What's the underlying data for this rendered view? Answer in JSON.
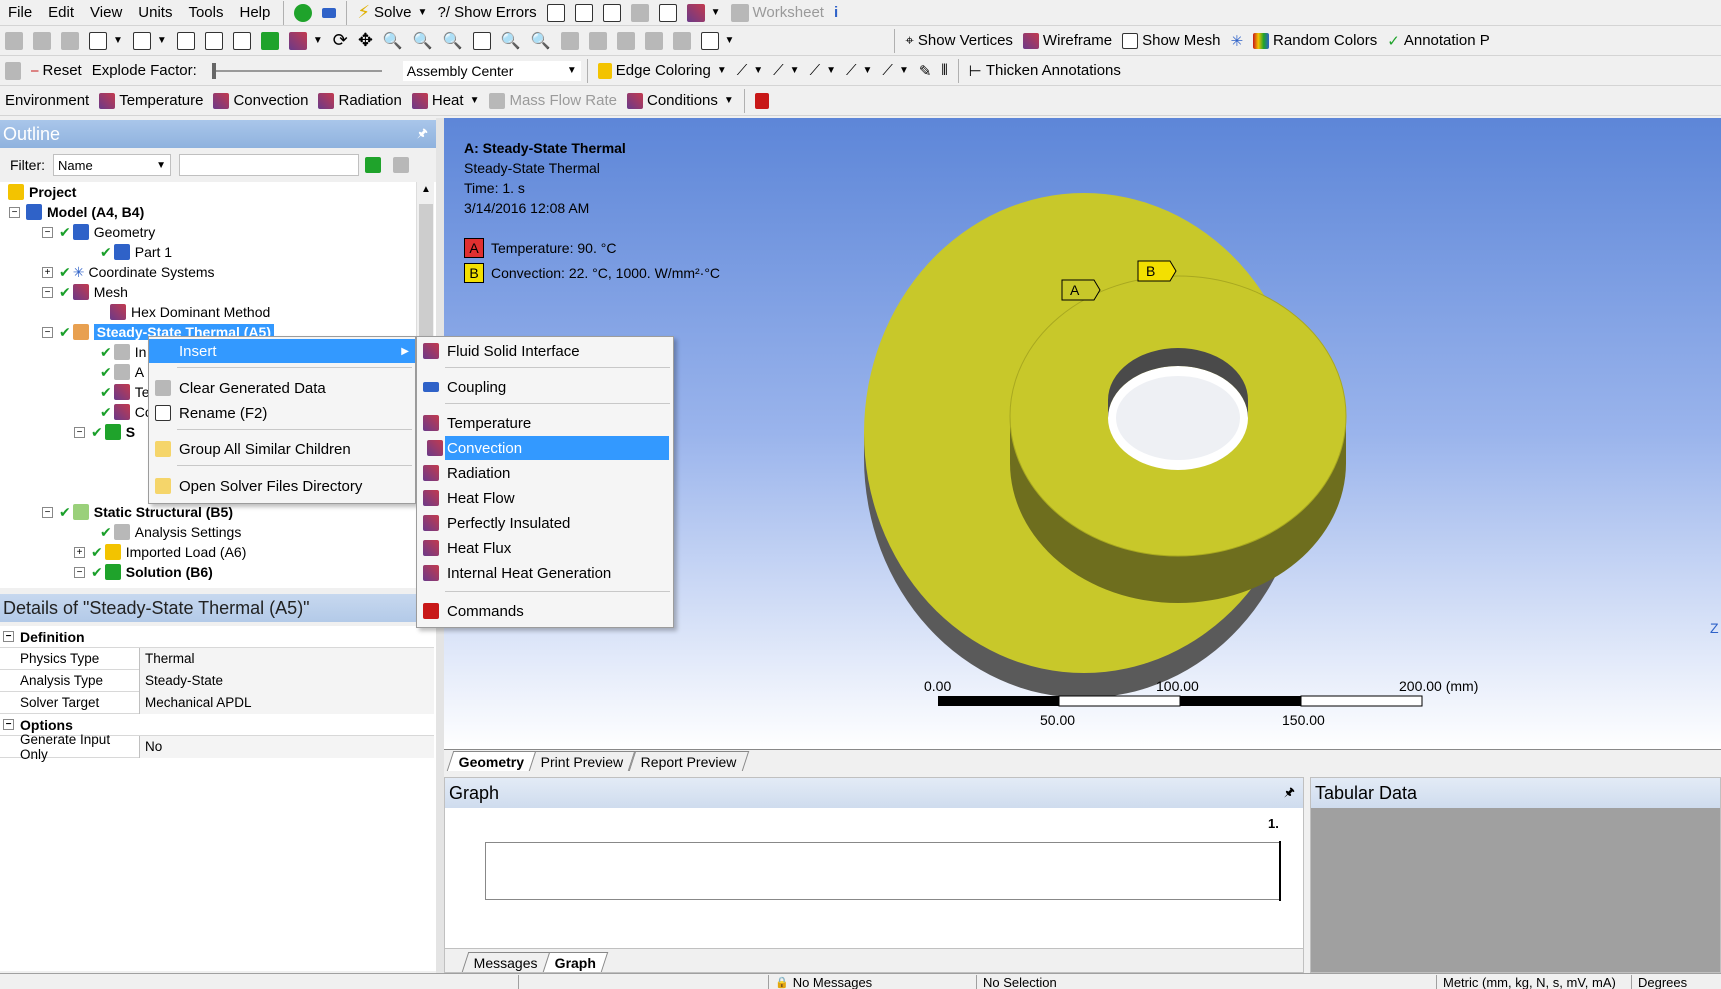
{
  "menu": [
    "File",
    "Edit",
    "View",
    "Units",
    "Tools",
    "Help"
  ],
  "toolbar1": {
    "solve": "Solve",
    "show_errors": "?/ Show Errors",
    "worksheet": "Worksheet"
  },
  "toolbar2": {
    "show_vertices": "Show Vertices",
    "wireframe": "Wireframe",
    "show_mesh": "Show Mesh",
    "random_colors": "Random Colors",
    "annotation": "Annotation P"
  },
  "toolbar3": {
    "reset": "Reset",
    "explode_factor": "Explode Factor:",
    "assembly_center": "Assembly Center",
    "edge_coloring": "Edge Coloring",
    "thicken_annotations": "Thicken Annotations"
  },
  "toolbar4": {
    "environment": "Environment",
    "temperature": "Temperature",
    "convection": "Convection",
    "radiation": "Radiation",
    "heat": "Heat",
    "mass_flow_rate": "Mass Flow Rate",
    "conditions": "Conditions"
  },
  "outline": {
    "title": "Outline",
    "filter_label": "Filter:",
    "filter_value": "Name",
    "tree": {
      "project": "Project",
      "model": "Model (A4, B4)",
      "geometry": "Geometry",
      "part1": "Part 1",
      "coord": "Coordinate Systems",
      "mesh": "Mesh",
      "hex": "Hex Dominant Method",
      "sst": "Steady-State Thermal (A5)",
      "partial1": "In",
      "partial2": "A",
      "partial3": "Te",
      "partial4": "Co",
      "partial5": "S",
      "static": "Static Structural (B5)",
      "analysis": "Analysis Settings",
      "imported": "Imported Load (A6)",
      "solution": "Solution (B6)"
    }
  },
  "context_menu": {
    "insert": "Insert",
    "clear": "Clear Generated Data",
    "rename": "Rename (F2)",
    "group": "Group All Similar Children",
    "open_dir": "Open Solver Files Directory"
  },
  "submenu": {
    "fluid": "Fluid Solid Interface",
    "coupling": "Coupling",
    "temperature": "Temperature",
    "convection": "Convection",
    "radiation": "Radiation",
    "heat_flow": "Heat Flow",
    "insulated": "Perfectly Insulated",
    "heat_flux": "Heat Flux",
    "internal": "Internal Heat Generation",
    "commands": "Commands"
  },
  "details": {
    "title": "Details of \"Steady-State Thermal (A5)\"",
    "definition": "Definition",
    "physics_k": "Physics Type",
    "physics_v": "Thermal",
    "analysis_k": "Analysis Type",
    "analysis_v": "Steady-State",
    "solver_k": "Solver Target",
    "solver_v": "Mechanical APDL",
    "options": "Options",
    "gen_k": "Generate Input Only",
    "gen_v": "No"
  },
  "viewport": {
    "title": "A: Steady-State Thermal",
    "subtitle": "Steady-State Thermal",
    "time": "Time: 1. s",
    "date": "3/14/2016 12:08 AM",
    "legend_a_letter": "A",
    "legend_a": "Temperature: 90. °C",
    "legend_b_letter": "B",
    "legend_b": "Convection: 22. °C, 1000. W/mm²·°C",
    "tag_a": "A",
    "tag_b": "B",
    "scale": [
      "0.00",
      "100.00",
      "200.00 (mm)",
      "50.00",
      "150.00"
    ],
    "axis_z": "Z",
    "colors": {
      "part": "#c8c82a",
      "bg_top": "#5d86d8"
    }
  },
  "view_tabs": [
    "Geometry",
    "Print Preview",
    "Report Preview"
  ],
  "graph": {
    "title": "Graph",
    "time_label": "1."
  },
  "tabular": {
    "title": "Tabular Data"
  },
  "bottom_tabs": [
    "Messages",
    "Graph"
  ],
  "status": {
    "messages": "No Messages",
    "selection": "No Selection",
    "units": "Metric (mm, kg, N, s, mV, mA)",
    "degrees": "Degrees"
  }
}
